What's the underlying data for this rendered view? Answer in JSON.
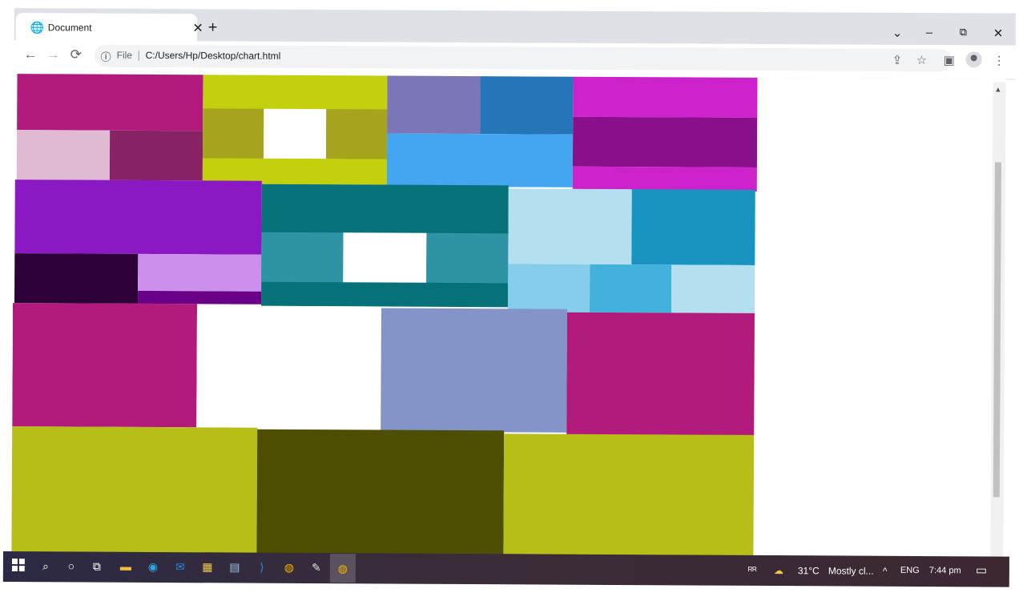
{
  "browser": {
    "tab_title": "Document",
    "tab_close": "✕",
    "new_tab": "+",
    "window_controls": {
      "dropdown": "⌄",
      "minimize": "–",
      "restore": "⧉",
      "close": "✕"
    },
    "nav": {
      "back": "←",
      "forward": "→",
      "reload": "⟳"
    },
    "address": {
      "info_icon": "ⓘ",
      "scheme_label": "File",
      "separator": "|",
      "url": "C:/Users/Hp/Desktop/chart.html"
    },
    "toolbar_icons": {
      "share": "⇪",
      "bookmark": "☆",
      "sidepanel": "▣",
      "menu": "⋮"
    }
  },
  "treemap": {
    "colors": {
      "magenta_dark": "#b11a7c",
      "pink_light": "#e0b9d2",
      "plum": "#882264",
      "lime": "#c2d00d",
      "olive": "#a6a41f",
      "white": "#ffffff",
      "lavender": "#7a76b8",
      "steel_blue": "#2476b8",
      "sky": "#44a6f0",
      "orchid": "#cc22cc",
      "purple_dark": "#8a0f8a",
      "violet": "#8a19c4",
      "aubergine": "#2e0039",
      "lilac": "#cc90ec",
      "purple": "#6a0086",
      "teal_dark": "#07717a",
      "teal": "#2e93a2",
      "powder": "#b3dfee",
      "cerulean": "#1994c0",
      "light_sky": "#84ceec",
      "blue_mid": "#42b1dc",
      "periwinkle": "#8394c8",
      "magenta": "#b21a7c",
      "chartreuse": "#b6be17",
      "dark_olive": "#4e4e00"
    }
  },
  "scrollbar": {
    "up": "▲",
    "down": "▼"
  },
  "taskbar": {
    "start_icon": "windows-logo",
    "tray": {
      "people": "ᴿᴿ",
      "weather_temp": "31°C",
      "weather_text": "Mostly cl...",
      "chevron": "^",
      "lang": "ENG",
      "time": "7:44 pm",
      "notification": "▭"
    }
  }
}
